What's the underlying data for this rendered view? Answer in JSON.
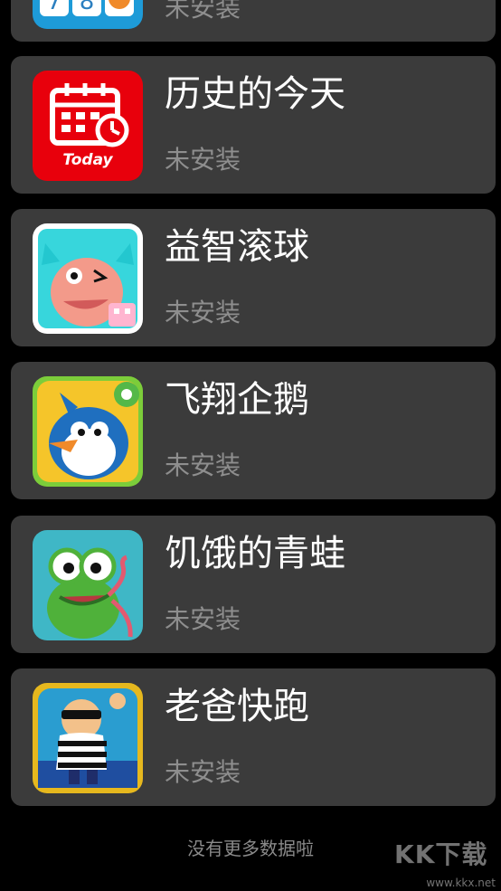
{
  "apps": [
    {
      "title": "",
      "status": "未安装",
      "icon": "number-game-icon"
    },
    {
      "title": "历史的今天",
      "status": "未安装",
      "icon": "calendar-today-icon",
      "icon_text": "Today"
    },
    {
      "title": "益智滚球",
      "status": "未安装",
      "icon": "owl-creature-icon"
    },
    {
      "title": "飞翔企鹅",
      "status": "未安装",
      "icon": "penguin-icon"
    },
    {
      "title": "饥饿的青蛙",
      "status": "未安装",
      "icon": "frog-icon"
    },
    {
      "title": "老爸快跑",
      "status": "未安装",
      "icon": "robber-icon"
    }
  ],
  "footer_text": "没有更多数据啦",
  "watermark": {
    "big": "KK下载",
    "small": "www.kkx.net"
  },
  "colors": {
    "background": "#000000",
    "card": "#3b3b3b",
    "title": "#ffffff",
    "status": "#8e8e8e"
  }
}
